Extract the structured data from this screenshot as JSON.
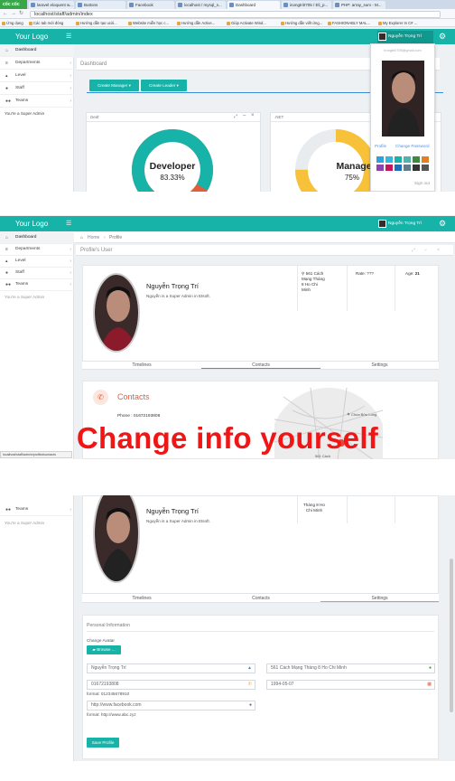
{
  "browser": {
    "brand": "cốc cốc",
    "url": "localhost/staff/admin/index",
    "tabs": [
      "laravel eloquent w...",
      "Buttons",
      "Facebook",
      "localhost / mysql_s...",
      "Dashboard",
      "inongtri0705 / Eli_p...",
      "PHP: array_sum - M..."
    ],
    "bookmarks": [
      "Ứng dụng",
      "Các tab mới đóng",
      "Hướng dẫn tạo ució...",
      "Website miễn học c...",
      "Hướng dẫn Active...",
      "Giúp Activate Wind...",
      "Hướng dẫn viết ứng...",
      "FASHIONABLY MAL...",
      "My Explorer In C# ..."
    ]
  },
  "app": {
    "logo": "Your Logo",
    "user_name": "Nguyễn Trọng Trí",
    "admin_label": "You're a Super Admin",
    "sidebar": [
      {
        "label": "Dashboard",
        "icon": "home-icon"
      },
      {
        "label": "Departments",
        "icon": "list-icon"
      },
      {
        "label": "Level",
        "icon": "level-icon"
      },
      {
        "label": "Staff",
        "icon": "user-icon"
      },
      {
        "label": "Teams",
        "icon": "users-icon"
      }
    ]
  },
  "dashboard": {
    "breadcrumb": "Dashboard",
    "btn_manager": "Create Manager",
    "btn_leader": "Create Leader",
    "panel_left_title": "Dedt",
    "panel_right_title": ".NET",
    "donut_left": {
      "label": "Developer",
      "pct_text": "83.33%",
      "value": 83.33
    },
    "donut_right": {
      "label": "Manage",
      "pct_text": "75%",
      "value": 75
    },
    "dropdown": {
      "email": "trongtri0705@gmail.com",
      "profile": "Profile",
      "change_password": "Change Password",
      "sign_out": "Sign out",
      "swatches": [
        "#2fa3d9",
        "#35b8e0",
        "#17b3a8",
        "#4db6ac",
        "#3c8a3c",
        "#e67e22",
        "#8e44ad",
        "#c2185b",
        "#1e6fb8",
        "#607d8b",
        "#333333",
        "#555555"
      ]
    }
  },
  "profile": {
    "crumb_home": "Home",
    "crumb_page": "Profile",
    "section_title": "Profile's User",
    "name": "Nguyễn Trọng Trí",
    "desc": "Nguyễn is a Super Admin in Etsoft.",
    "address": "561 Cách Mạng Tháng 8 Ho Chi Minh",
    "rate_label": "Rate:",
    "rate_value": "???",
    "age_label": "Age:",
    "age_value": "21",
    "tabs": [
      "Timelines",
      "Contacts",
      "Settings"
    ],
    "contacts_title": "Contacts",
    "phone_label": "Phone :",
    "phone": "01672193808",
    "map_label1": "Chùa Bửu Long",
    "map_label2": "561 Cách",
    "status_url": "localhost/staff/admin/profile#contacts"
  },
  "caption": "Change info yourself",
  "settings": {
    "section": "Personal Information",
    "change_avatar": "Change Avatar",
    "browse": "Browse ...",
    "name_value": "Nguyễn Trọng Trí",
    "address_value": "561 Cách Mạng Tháng 8 Ho Chi Minh",
    "phone_value": "01672193808",
    "birthday_value": "1994-05-07",
    "phone_format": "format: 012345678910",
    "facebook_placeholder": "http://www.facebook.com",
    "facebook_format": "format: http://www.abc.zyz",
    "save": "Save Profile",
    "address_short": "Tháng 8 Ho Chi Minh"
  }
}
